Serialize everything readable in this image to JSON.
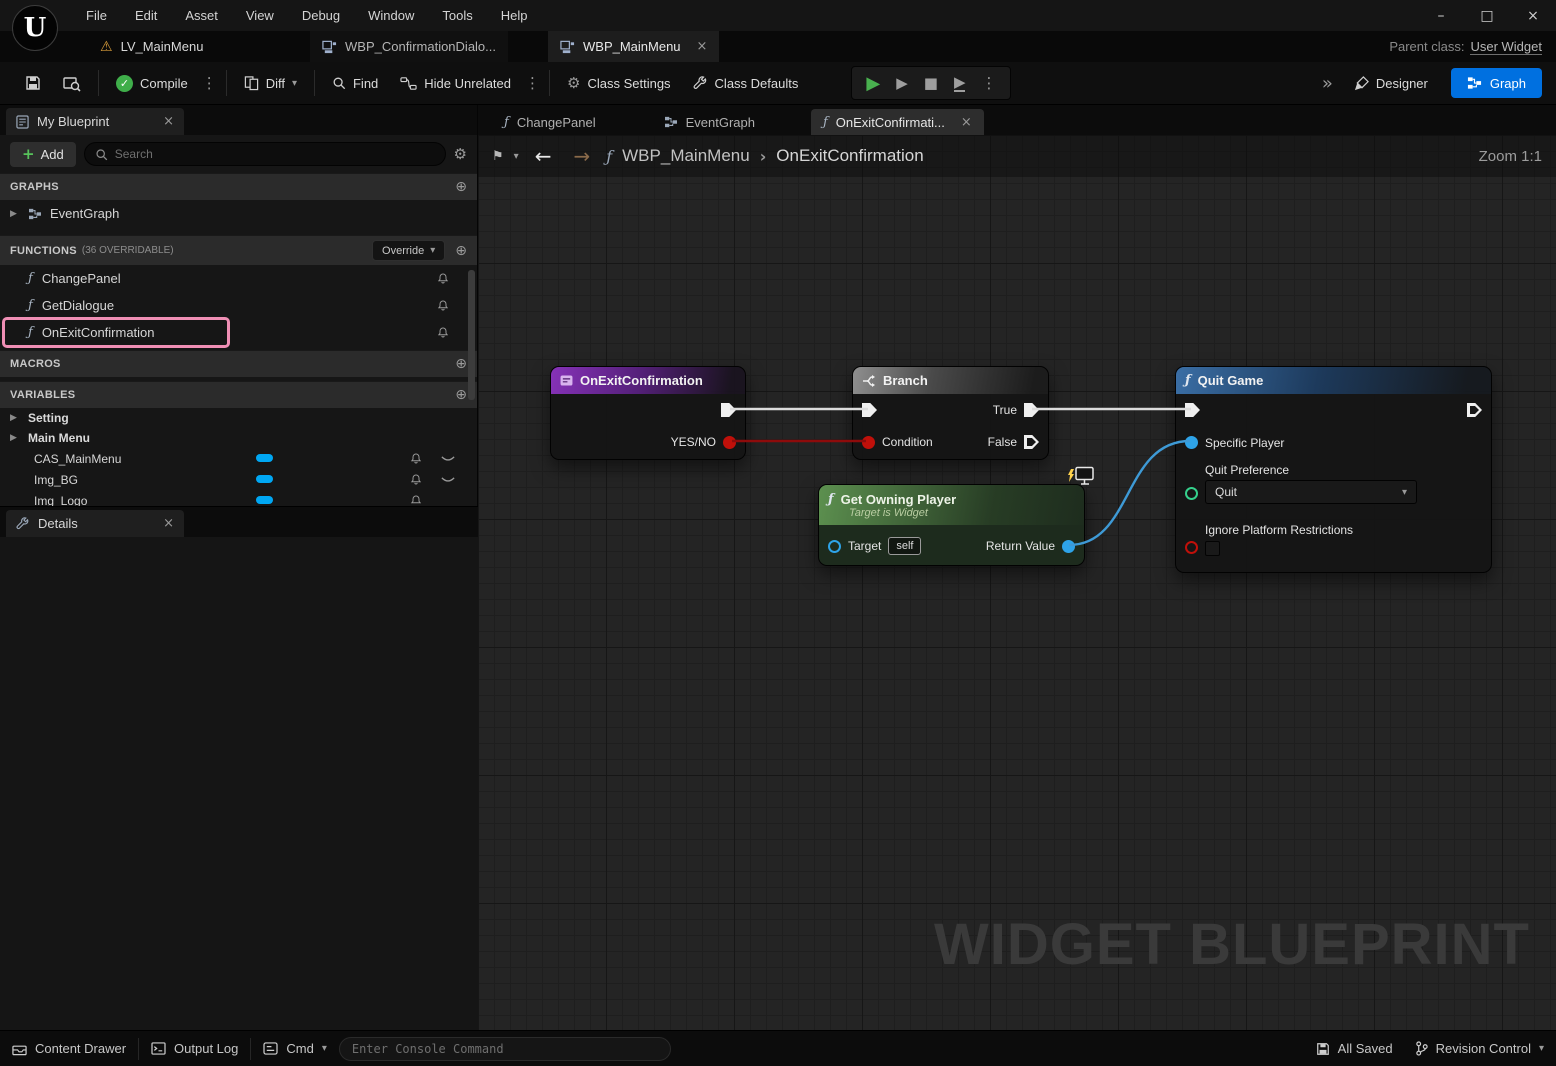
{
  "colors": {
    "accent_blue": "#0070e0",
    "compile_green": "#3fae4a",
    "highlight_pink": "#ef8fb5",
    "exec_wire_white": "#dcdcdc",
    "bool_pin_red": "#c0100a",
    "object_pin_blue": "#2ea3e8",
    "enum_pin_green": "#35d08c",
    "node_entry_purple": "#8632b8",
    "node_branch_gray": "#8f8f8f",
    "node_pure_green": "#5f9652",
    "node_quit_blue": "#3a6ea5",
    "variable_pill_blue": "#00a7f3"
  },
  "icons": {
    "logo": "U",
    "warning": "⚠",
    "close": "×",
    "minimize": "–",
    "maximize": "□",
    "kebab": "⋮",
    "chevron_down": "▾",
    "check": "✓",
    "play": "▶",
    "frame_skip": "▶",
    "stop": "■",
    "launch": "▶",
    "overflow": "»",
    "back_arrow": "←",
    "forward_arrow": "→",
    "fn": "ƒ",
    "bookmark": "⚑",
    "crumb_sep": "›",
    "plus_circle": "⊕",
    "plus": "+",
    "gear": "⚙",
    "tree_arrow": "▶"
  },
  "menubar": [
    "File",
    "Edit",
    "Asset",
    "View",
    "Debug",
    "Window",
    "Tools",
    "Help"
  ],
  "titlebar": {
    "level_tab": "LV_MainMenu",
    "tabs": [
      "WBP_ConfirmationDialo...",
      "WBP_MainMenu"
    ],
    "parent_class_label": "Parent class:",
    "parent_class_value": "User Widget"
  },
  "toolbar": {
    "compile": "Compile",
    "diff": "Diff",
    "find": "Find",
    "hide_unrelated": "Hide Unrelated",
    "class_settings": "Class Settings",
    "class_defaults": "Class Defaults",
    "designer": "Designer",
    "graph": "Graph"
  },
  "my_blueprint": {
    "title": "My Blueprint",
    "add_label": "Add",
    "search_placeholder": "Search",
    "graphs": {
      "header": "GRAPHS",
      "items": [
        "EventGraph"
      ]
    },
    "functions": {
      "header": "FUNCTIONS",
      "sub": "(36 OVERRIDABLE)",
      "override": "Override",
      "items": [
        "ChangePanel",
        "GetDialogue",
        "OnExitConfirmation"
      ]
    },
    "macros": {
      "header": "MACROS"
    },
    "variables": {
      "header": "VARIABLES",
      "categories": [
        "Setting",
        "Main Menu"
      ],
      "items": [
        "CAS_MainMenu",
        "Img_BG",
        "Img_Logo"
      ]
    }
  },
  "details": {
    "title": "Details"
  },
  "graph": {
    "tabs": [
      "ChangePanel",
      "EventGraph",
      "OnExitConfirmati..."
    ],
    "breadcrumb": {
      "root": "WBP_MainMenu",
      "current": "OnExitConfirmation"
    },
    "zoom": "Zoom 1:1",
    "watermark": "WIDGET BLUEPRINT",
    "nodes": {
      "entry": {
        "title": "OnExitConfirmation",
        "out_pin": "YES/NO"
      },
      "branch": {
        "title": "Branch",
        "condition": "Condition",
        "true_label": "True",
        "false_label": "False"
      },
      "get_owning_player": {
        "title": "Get Owning Player",
        "subtitle": "Target is Widget",
        "target_label": "Target",
        "target_value": "self",
        "return_label": "Return Value"
      },
      "quit_game": {
        "title": "Quit Game",
        "specific_player": "Specific Player",
        "quit_preference": "Quit Preference",
        "quit_value": "Quit",
        "ignore_label": "Ignore Platform Restrictions"
      }
    }
  },
  "statusbar": {
    "content_drawer": "Content Drawer",
    "output_log": "Output Log",
    "cmd": "Cmd",
    "console_placeholder": "Enter Console Command",
    "all_saved": "All Saved",
    "revision_control": "Revision Control"
  }
}
